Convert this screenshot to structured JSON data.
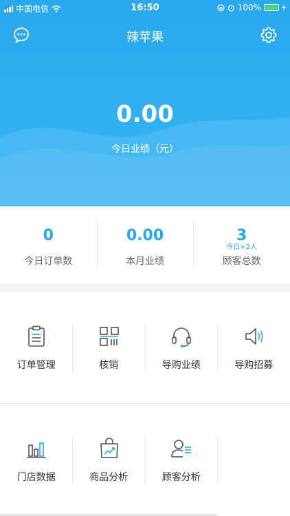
{
  "status_bar": {
    "carrier": "中国电信",
    "time": "16:50",
    "battery": "100%"
  },
  "nav": {
    "title": "辣苹果"
  },
  "summary": {
    "value": "0.00",
    "label": "今日业绩（元）"
  },
  "stats": [
    {
      "value": "0",
      "label": "今日订单数",
      "sub": ""
    },
    {
      "value": "0.00",
      "label": "本月业绩",
      "sub": ""
    },
    {
      "value": "3",
      "label": "顾客总数",
      "sub": "今日+2人"
    }
  ],
  "grid": {
    "row1": [
      {
        "label": "订单管理",
        "icon": "clipboard-icon"
      },
      {
        "label": "核销",
        "icon": "qr-code-icon"
      },
      {
        "label": "导购业绩",
        "icon": "headset-icon"
      },
      {
        "label": "导购招募",
        "icon": "speaker-icon"
      }
    ],
    "row2": [
      {
        "label": "门店数据",
        "icon": "bar-chart-icon"
      },
      {
        "label": "商品分析",
        "icon": "shopping-bag-chart-icon"
      },
      {
        "label": "顾客分析",
        "icon": "user-list-icon"
      }
    ]
  },
  "colors": {
    "primary": "#2aa8ef",
    "battery": "#4cd964"
  }
}
